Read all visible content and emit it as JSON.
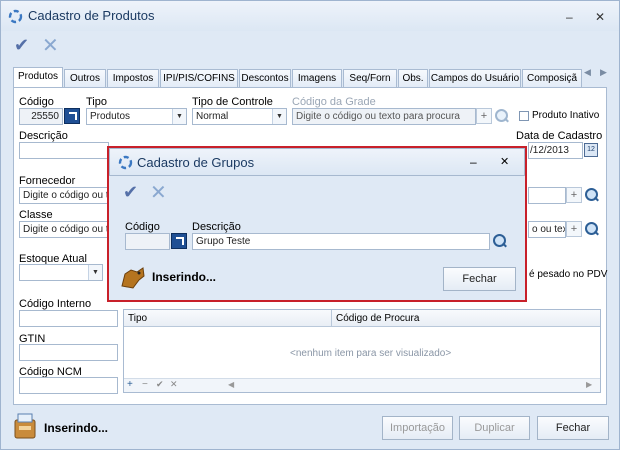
{
  "window": {
    "title": "Cadastro de Produtos",
    "minimize": "–",
    "close": "✕"
  },
  "toolbar": {
    "confirm_icon": "check-icon",
    "cancel_icon": "x-icon"
  },
  "tabs": [
    "Produtos",
    "Outros",
    "Impostos",
    "IPI/PIS/COFINS",
    "Descontos",
    "Imagens",
    "Seq/Forn",
    "Obs.",
    "Campos do Usuário",
    "Composiçã"
  ],
  "form": {
    "codigo_label": "Código",
    "codigo_value": "25550",
    "tipo_label": "Tipo",
    "tipo_value": "Produtos",
    "tipo_controle_label": "Tipo de Controle",
    "tipo_controle_value": "Normal",
    "codigo_grade_label": "Código da Grade",
    "codigo_grade_placeholder": "Digite o código ou texto para procura",
    "produto_inativo_label": "Produto Inativo",
    "descricao_label": "Descrição",
    "data_cadastro_label": "Data de Cadastro",
    "data_cadastro_value": "/12/2013",
    "fornecedor_label": "Fornecedor",
    "fornecedor_placeholder": "Digite o código ou tex",
    "classe_label": "Classe",
    "classe_placeholder": "Digite o código ou tex",
    "right_placeholder_fragment": "o ou texto p",
    "estoque_atual_label": "Estoque Atual",
    "pesado_label": "é pesado no PDV",
    "codigo_interno_label": "Código Interno",
    "gtin_label": "GTIN",
    "codigo_ncm_label": "Código NCM"
  },
  "grid": {
    "columns": [
      "Tipo",
      "Código de Procura"
    ],
    "empty_text": "<nenhum item para ser visualizado>",
    "nav": [
      "+",
      "−",
      "✔",
      "✕"
    ]
  },
  "footer": {
    "status": "Inserindo...",
    "importacao": "Importação",
    "duplicar": "Duplicar",
    "fechar": "Fechar"
  },
  "dialog": {
    "title": "Cadastro de Grupos",
    "codigo_label": "Código",
    "descricao_label": "Descrição",
    "descricao_value": "Grupo Teste",
    "status": "Inserindo...",
    "fechar": "Fechar",
    "minimize": "–",
    "close": "✕"
  },
  "colors": {
    "frame": "#dfe9f5",
    "highlight": "#c8202a",
    "accent": "#1f4f94"
  }
}
